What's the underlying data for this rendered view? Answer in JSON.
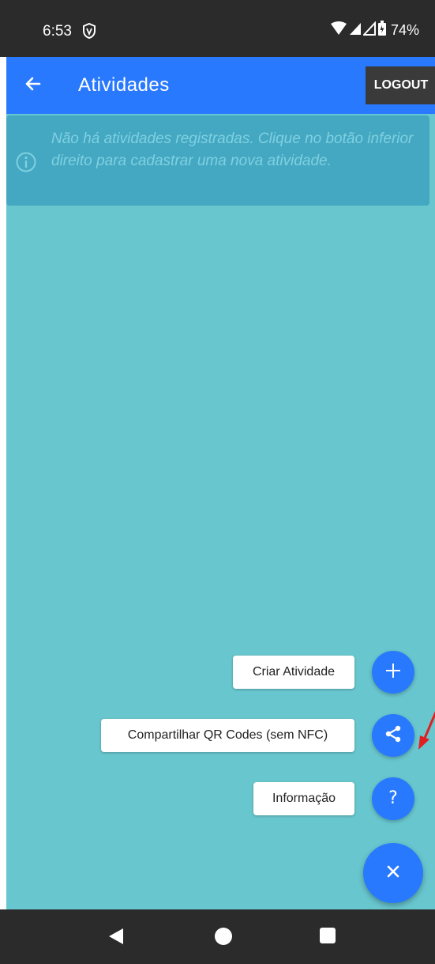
{
  "status_bar": {
    "time": "6:53",
    "battery": "74%",
    "icons": [
      "vpn-shield-icon",
      "wifi-icon",
      "signal-icon",
      "signal-icon",
      "battery-icon"
    ]
  },
  "app_bar": {
    "title": "Atividades",
    "logout_label": "LOGOUT",
    "back_icon": "arrow-back-icon",
    "color": "#2979ff"
  },
  "info_banner": {
    "icon": "info-icon",
    "message": "Não há atividades registradas. Clique no botão inferior direito para cadastrar uma nova atividade."
  },
  "speed_dial": {
    "actions": [
      {
        "label": "Criar Atividade",
        "icon": "plus-icon"
      },
      {
        "label": "Compartilhar QR Codes (sem NFC)",
        "icon": "share-icon"
      },
      {
        "label": "Informação",
        "icon": "help-icon"
      }
    ],
    "main_icon": "close-icon"
  },
  "nav_bar": {
    "icons": [
      "nav-back-icon",
      "nav-home-icon",
      "nav-recents-icon"
    ]
  },
  "colors": {
    "background": "#68c6ce",
    "banner": "#44a8c2",
    "accent": "#2979ff",
    "annotation": "#e02020"
  }
}
